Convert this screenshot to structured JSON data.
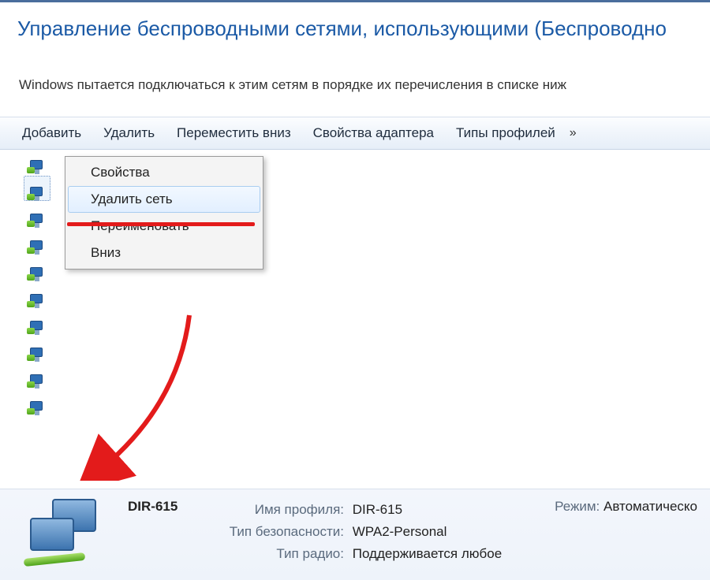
{
  "header": {
    "title": "Управление беспроводными сетями, использующими (Беспроводно",
    "subtitle": "Windows пытается подключаться к этим сетям в порядке их перечисления в списке ниж"
  },
  "toolbar": {
    "add": "Добавить",
    "remove": "Удалить",
    "move_down": "Переместить вниз",
    "adapter_props": "Свойства адаптера",
    "profile_types": "Типы профилей",
    "more": "»"
  },
  "context_menu": {
    "properties": "Свойства",
    "delete_network": "Удалить сеть",
    "rename": "Переименовать",
    "down": "Вниз"
  },
  "network_items_count": 10,
  "details": {
    "name": "DIR-615",
    "profile_label": "Имя профиля:",
    "profile_value": "DIR-615",
    "security_label": "Тип безопасности:",
    "security_value": "WPA2-Personal",
    "radio_label": "Тип радио:",
    "radio_value": "Поддерживается любое",
    "mode_label": "Режим:",
    "mode_value": "Автоматическо"
  }
}
